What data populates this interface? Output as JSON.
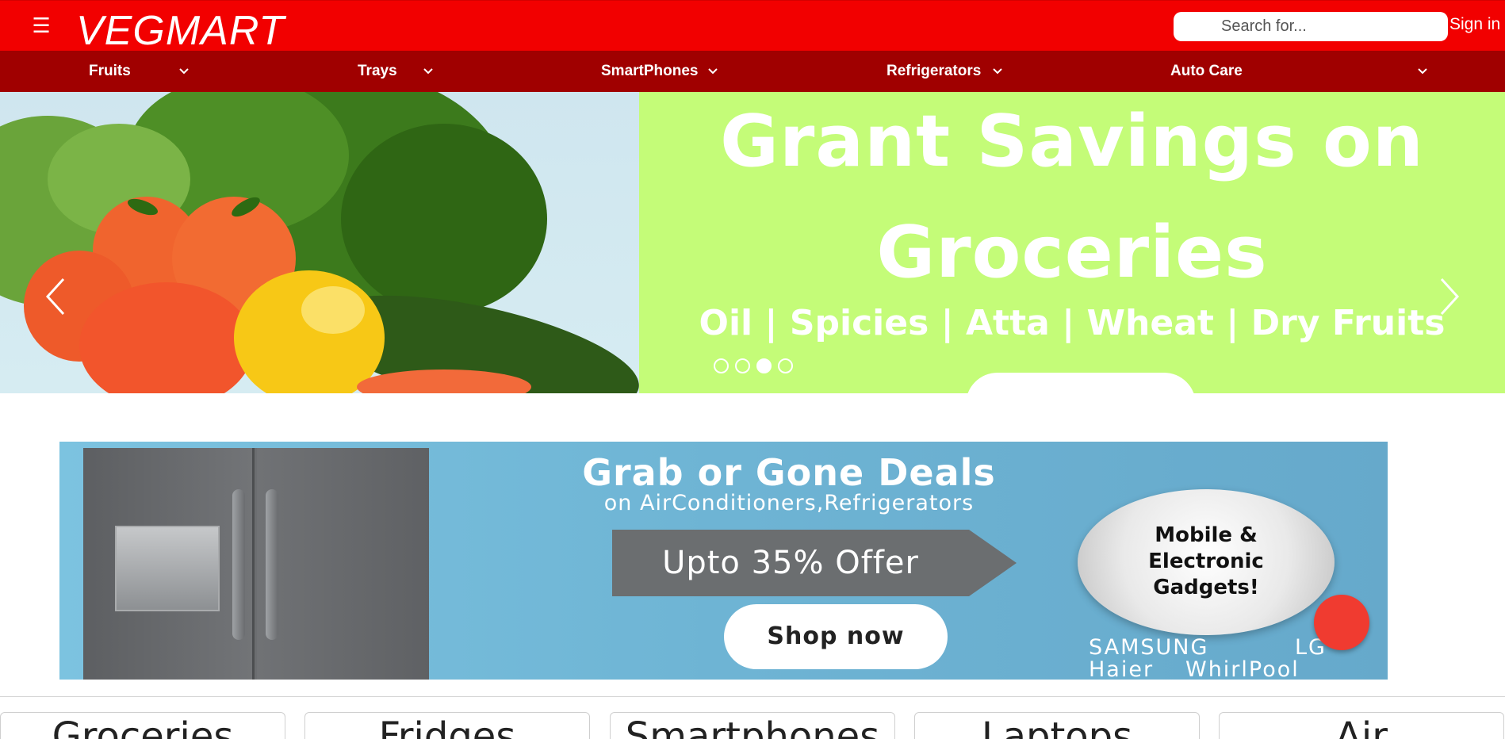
{
  "header": {
    "menu_icon": "hamburger-icon",
    "menu_glyph": "☰",
    "logo": "VEGMART",
    "search_placeholder": "Search for...",
    "signin_label": "Sign in",
    "bg_color": "#f20000"
  },
  "nav": {
    "bg_color": "#a00000",
    "items": [
      {
        "label": "Fruits",
        "icon": "chevron-down-icon"
      },
      {
        "label": "Trays",
        "icon": "chevron-down-icon"
      },
      {
        "label": "SmartPhones",
        "icon": "chevron-down-icon"
      },
      {
        "label": "Refrigerators",
        "icon": "chevron-down-icon"
      },
      {
        "label": "Auto Care",
        "icon": "chevron-down-icon"
      }
    ]
  },
  "hero": {
    "title_line1": "Grant Savings on",
    "title_line2": "Groceries",
    "subtitle": "Oil | Spicies | Atta | Wheat | Dry Fruits",
    "bg_color": "#c4fc78",
    "prev_icon": "chevron-left-icon",
    "next_icon": "chevron-right-icon",
    "slide_count": 4,
    "active_slide": 3
  },
  "promo": {
    "title": "Grab or Gone Deals",
    "subtitle": "on AirConditioners,Refrigerators",
    "offer": "Upto 35% Offer",
    "shop_button": "Shop now",
    "bubble_line1": "Mobile &",
    "bubble_line2": "Electronic",
    "bubble_line3": "Gadgets!",
    "brand1": "SAMSUNG",
    "brand2": "LG",
    "brand3": "Haier",
    "brand4": "WhirlPool"
  },
  "categories": [
    {
      "label": "Groceries"
    },
    {
      "label": "Fridges"
    },
    {
      "label": "Smartphones"
    },
    {
      "label": "Laptops"
    },
    {
      "label": "Air"
    }
  ]
}
